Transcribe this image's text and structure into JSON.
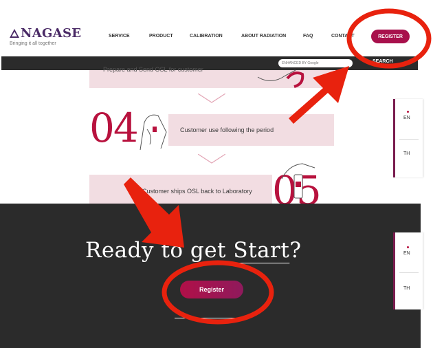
{
  "brand": {
    "name": "NAGASE",
    "tagline": "Bringing it all together"
  },
  "nav": {
    "items": [
      "SERVICE",
      "PRODUCT",
      "CALIBRATION",
      "ABOUT RADIATION",
      "FAQ",
      "CONTACT"
    ],
    "register_label": "REGISTER"
  },
  "search": {
    "placeholder": "ENHANCED BY Google",
    "button_label": "SEARCH"
  },
  "steps": {
    "step3_text": "Prepare and Send OSL for customer",
    "step4_number": "04",
    "step4_text": "Customer use following the period",
    "step5_number": "05",
    "step5_text": "Customer ships OSL back to Laboratory"
  },
  "language": {
    "options": [
      "EN",
      "TH"
    ]
  },
  "cta": {
    "title_prefix": "Ready to get ",
    "title_accent": "Start",
    "title_suffix": "?",
    "button_label": "Register"
  },
  "colors": {
    "brand": "#a8104c",
    "accent_red": "#b8123e",
    "dark_bg": "#2b2b2b",
    "step_band": "#f2dde2",
    "annotation_red": "#e8220e"
  }
}
